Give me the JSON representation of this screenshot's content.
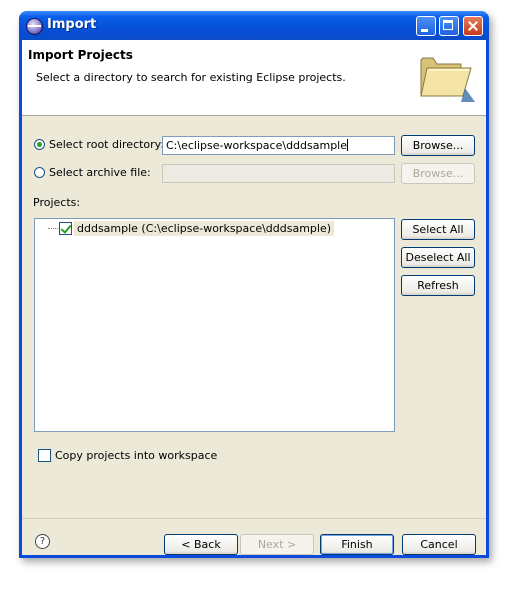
{
  "window": {
    "title": "Import"
  },
  "banner": {
    "title": "Import Projects",
    "description": "Select a directory to search for existing Eclipse projects.",
    "icon": "open-folder-icon"
  },
  "source": {
    "root_option_label": "Select root directory:",
    "root_selected": true,
    "root_value": "C:\\eclipse-workspace\\dddsample",
    "root_browse_label": "Browse...",
    "archive_option_label": "Select archive file:",
    "archive_selected": false,
    "archive_value": "",
    "archive_browse_label": "Browse..."
  },
  "projects": {
    "label": "Projects:",
    "items": [
      {
        "label": "dddsample (C:\\eclipse-workspace\\dddsample)",
        "checked": true
      }
    ],
    "select_all_label": "Select All",
    "deselect_all_label": "Deselect All",
    "refresh_label": "Refresh"
  },
  "options": {
    "copy_label": "Copy projects into workspace",
    "copy_checked": false
  },
  "footer": {
    "back_label": "< Back",
    "next_label": "Next >",
    "finish_label": "Finish",
    "cancel_label": "Cancel"
  }
}
